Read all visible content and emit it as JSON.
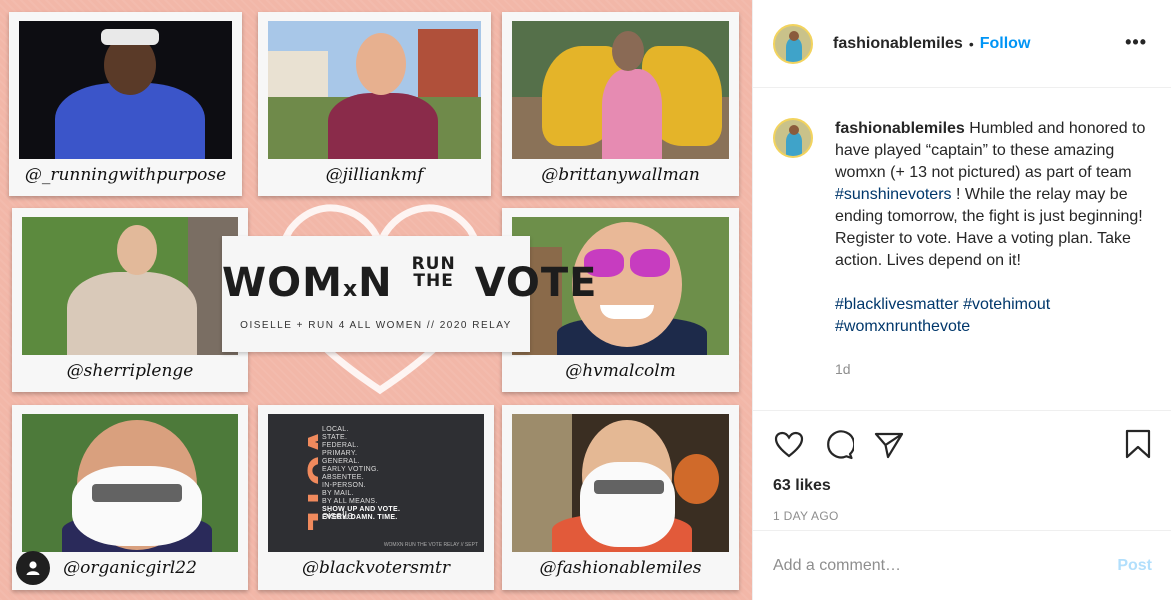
{
  "collage": {
    "title_left": "WOM",
    "title_x": "x",
    "title_n": "N",
    "title_run": "RUN",
    "title_the": "THE",
    "title_vote": "VOTE",
    "subtitle": "OISELLE + RUN 4 ALL WOMEN // 2020 RELAY",
    "handles": [
      "@_runningwithpurpose",
      "@jilliankmf",
      "@brittanywallman",
      "@sherriplenge",
      "@hvmalcolm",
      "@organicgirl22",
      "@blackvotersmtr",
      "@fashionablemiles"
    ],
    "voter_card": {
      "big": "VOTE",
      "lines": [
        "LOCAL.",
        "STATE.",
        "FEDERAL.",
        "PRIMARY.",
        "GENERAL.",
        "EARLY VOTING.",
        "ABSENTEE.",
        "IN-PERSON.",
        "BY MAIL.",
        "BY ALL MEANS.",
        "SHOW UP AND VOTE.",
        "EVERY. DAMN. TIME."
      ],
      "brand": "oiselle",
      "footer": "WOMXN RUN THE VOTE RELAY // SEPT"
    }
  },
  "post": {
    "username": "fashionablemiles",
    "separator": "•",
    "follow_label": "Follow",
    "more_label": "•••",
    "caption_user": "fashionablemiles",
    "caption_part1": " Humbled and honored to have played “captain” to these amazing womxn (+ 13 not pictured) as part of team ",
    "caption_tag1": "#sunshinevoters",
    "caption_part2": " ! While the relay may be ending tomorrow, the fight is just beginning! Register to vote. Have a voting plan. Take action. Lives depend on it!",
    "hashtags": [
      "#blacklivesmatter",
      "#votehimout",
      "#womxnrunthevote"
    ],
    "time_ago": "1d",
    "likes": "63 likes",
    "posted": "1 DAY AGO",
    "comment_placeholder": "Add a comment…",
    "post_label": "Post"
  },
  "icons": [
    "heart-icon",
    "comment-icon",
    "share-icon",
    "bookmark-icon",
    "user-icon",
    "more-icon"
  ],
  "colors": {
    "follow": "#0095f6",
    "hashtag": "#00376b",
    "background_pink": "#f2b7a8",
    "voter_orange": "#f08a5d"
  }
}
